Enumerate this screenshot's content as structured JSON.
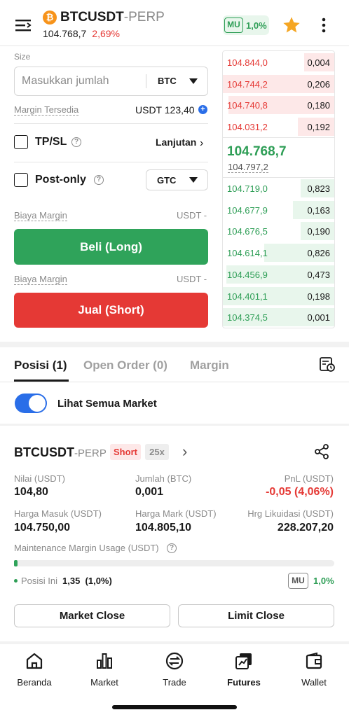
{
  "header": {
    "coin_symbol": "₿",
    "pair": "BTCUSDT",
    "pair_suffix": "-PERP",
    "last_price": "104.768,7",
    "change": "2,69%",
    "mu_label": "MU",
    "mu_value": "1,0%",
    "icons": [
      "menu-icon",
      "bitcoin-icon",
      "star-icon",
      "more-icon"
    ]
  },
  "form": {
    "size_label": "Size",
    "size_placeholder": "Masukkan jumlah",
    "size_unit": "BTC",
    "margin_label": "Margin Tersedia",
    "margin_value": "USDT 123,40",
    "tpsl_label": "TP/SL",
    "advanced_label": "Lanjutan",
    "postonly_label": "Post-only",
    "tif_value": "GTC",
    "fee_label_1": "Biaya Margin",
    "fee_value_1": "USDT -",
    "buy_label": "Beli (Long)",
    "fee_label_2": "Biaya Margin",
    "fee_value_2": "USDT -",
    "sell_label": "Jual (Short)"
  },
  "orderbook": {
    "asks": [
      {
        "price": "104.844,0",
        "qty": "0,004",
        "depth": 0.27
      },
      {
        "price": "104.744,2",
        "qty": "0,206",
        "depth": 1.0
      },
      {
        "price": "104.740,8",
        "qty": "0,180",
        "depth": 0.95
      },
      {
        "price": "104.031,2",
        "qty": "0,192",
        "depth": 0.33
      }
    ],
    "mid_price": "104.768,7",
    "mark_price": "104.797,2",
    "bids": [
      {
        "price": "104.719,0",
        "qty": "0,823",
        "depth": 0.3
      },
      {
        "price": "104.677,9",
        "qty": "0,163",
        "depth": 0.37
      },
      {
        "price": "104.676,5",
        "qty": "0,190",
        "depth": 0.3
      },
      {
        "price": "104.614,1",
        "qty": "0,826",
        "depth": 0.63
      },
      {
        "price": "104.456,9",
        "qty": "0,473",
        "depth": 0.97
      },
      {
        "price": "104.401,1",
        "qty": "0,198",
        "depth": 1.0
      },
      {
        "price": "104.374,5",
        "qty": "0,001",
        "depth": 1.0
      }
    ]
  },
  "tabs": {
    "positions": "Posisi (1)",
    "open_orders": "Open Order (0)",
    "margin": "Margin"
  },
  "toggle": {
    "label": "Lihat Semua Market",
    "on": true
  },
  "position": {
    "pair": "BTCUSDT",
    "pair_suffix": "-PERP",
    "side": "Short",
    "leverage": "25x",
    "nilai_label": "Nilai (USDT)",
    "nilai_value": "104,80",
    "jumlah_label": "Jumlah (BTC)",
    "jumlah_value": "0,001",
    "pnl_label": "PnL (USDT)",
    "pnl_value": "-0,05 (4,06%)",
    "entry_label": "Harga Masuk (USDT)",
    "entry_value": "104.750,00",
    "mark_label": "Harga Mark (USDT)",
    "mark_value": "104.805,10",
    "liq_label": "Hrg Likuidasi (USDT)",
    "liq_value": "228.207,20",
    "mmu_label": "Maintenance Margin Usage (USDT)",
    "mmu_progress": 0.01,
    "posisi_label": "Posisi Ini",
    "posisi_value": "1,35  (1,0%)",
    "mu_label": "MU",
    "mu_value": "1,0%",
    "market_close": "Market Close",
    "limit_close": "Limit Close"
  },
  "nav": {
    "items": [
      {
        "label": "Beranda",
        "icon": "home-icon"
      },
      {
        "label": "Market",
        "icon": "chart-icon"
      },
      {
        "label": "Trade",
        "icon": "exchange-icon"
      },
      {
        "label": "Futures",
        "icon": "futures-icon"
      },
      {
        "label": "Wallet",
        "icon": "wallet-icon"
      }
    ],
    "active": "Futures"
  },
  "colors": {
    "green": "#2fa35a",
    "red": "#e53935",
    "blue": "#2a6ee8",
    "bitcoin": "#f7931a",
    "star": "#f5a623"
  }
}
